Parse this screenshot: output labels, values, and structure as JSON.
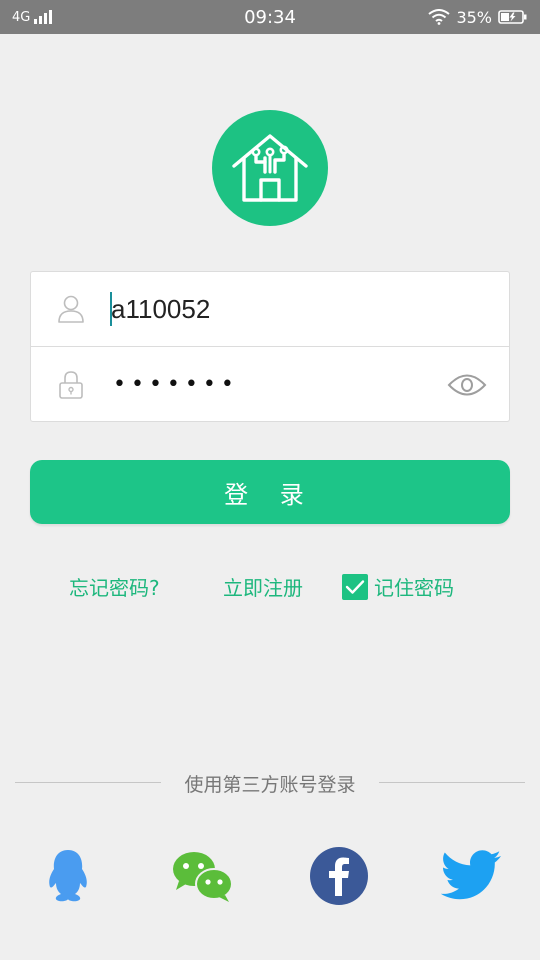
{
  "status_bar": {
    "network": "4G",
    "time": "09:34",
    "battery": "35%"
  },
  "login": {
    "username_value": "a110052",
    "password_masked": "•••••••",
    "submit_label": "登 录"
  },
  "links": {
    "forgot_password": "忘记密码?",
    "register": "立即注册",
    "remember_password": "记住密码",
    "remember_checked": true
  },
  "third_party": {
    "title": "使用第三方账号登录",
    "providers": [
      "qq-icon",
      "wechat-icon",
      "facebook-icon",
      "twitter-icon"
    ]
  },
  "colors": {
    "accent": "#1dc283",
    "status_bar": "#7d7d7d",
    "background": "#efefef",
    "link": "#1db77d",
    "facebook": "#3b5998",
    "twitter": "#1da1f2",
    "qq": "#4a9cf0",
    "wechat": "#5bbd3a"
  }
}
